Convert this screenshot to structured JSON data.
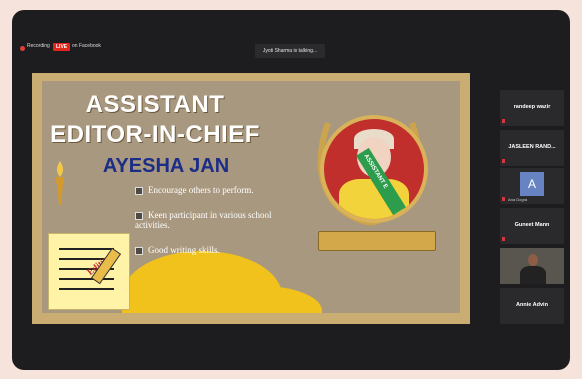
{
  "header": {
    "recording_label": "Recording",
    "live_label": "LIVE",
    "live_platform": "on Facebook",
    "talking": "Jyoti Sharma is talking..."
  },
  "slide": {
    "title_line1": "ASSISTANT",
    "title_line2": "EDITOR-IN-CHIEF",
    "name": "AYESHA JAN",
    "bullets": [
      "Encourage others to perform.",
      "Keen participant in various school activities.",
      "Good writing skills."
    ],
    "note_text": "Editing",
    "sash_text": "ASSISTANT E"
  },
  "participants": [
    {
      "name": "randeep wazir",
      "type": "name"
    },
    {
      "name": "JASLEEN RAND...",
      "type": "name"
    },
    {
      "name": "A",
      "label": "Ana Dogra",
      "type": "avatar"
    },
    {
      "name": "Guneet Mann",
      "type": "name"
    },
    {
      "name": "",
      "type": "video"
    },
    {
      "name": "Annie Advin",
      "type": "name"
    }
  ],
  "colors": {
    "live_red": "#e1261c",
    "slide_bg": "#a8987f",
    "name_blue": "#1b2d87",
    "accent_yellow": "#f1c21b"
  }
}
